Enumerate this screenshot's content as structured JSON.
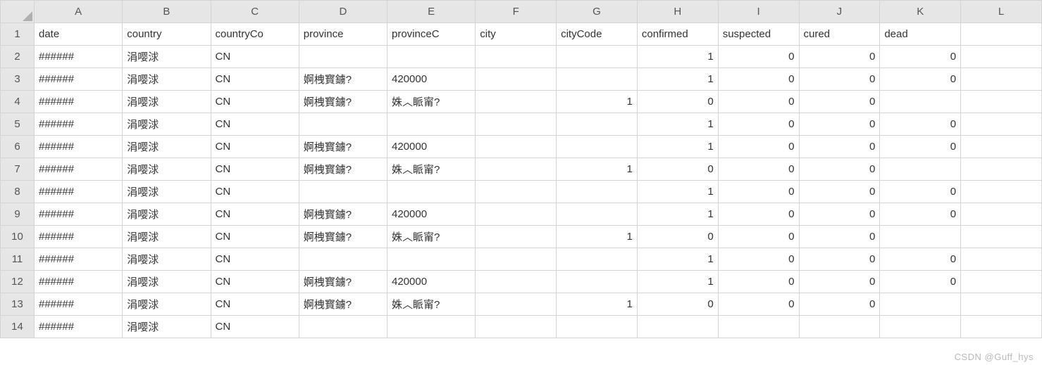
{
  "columns": [
    "A",
    "B",
    "C",
    "D",
    "E",
    "F",
    "G",
    "H",
    "I",
    "J",
    "K",
    "L"
  ],
  "headers": [
    "date",
    "country",
    "countryCo",
    "province",
    "provinceC",
    "city",
    "cityCode",
    "confirmed",
    "suspected",
    "cured",
    "dead",
    ""
  ],
  "rows": [
    [
      "######",
      "涓嘤浗",
      "CN",
      "",
      "",
      "",
      "",
      "1",
      "0",
      "0",
      "0",
      ""
    ],
    [
      "######",
      "涓嘤浗",
      "CN",
      "婀栧寳鐪?",
      "420000",
      "",
      "",
      "1",
      "0",
      "0",
      "0",
      ""
    ],
    [
      "######",
      "涓嘤浗",
      "CN",
      "婀栧寳鐪?",
      "姝︿眽甯?",
      "",
      "1",
      "0",
      "0",
      "0",
      "",
      ""
    ],
    [
      "######",
      "涓嘤浗",
      "CN",
      "",
      "",
      "",
      "",
      "1",
      "0",
      "0",
      "0",
      ""
    ],
    [
      "######",
      "涓嘤浗",
      "CN",
      "婀栧寳鐪?",
      "420000",
      "",
      "",
      "1",
      "0",
      "0",
      "0",
      ""
    ],
    [
      "######",
      "涓嘤浗",
      "CN",
      "婀栧寳鐪?",
      "姝︿眽甯?",
      "",
      "1",
      "0",
      "0",
      "0",
      "",
      ""
    ],
    [
      "######",
      "涓嘤浗",
      "CN",
      "",
      "",
      "",
      "",
      "1",
      "0",
      "0",
      "0",
      ""
    ],
    [
      "######",
      "涓嘤浗",
      "CN",
      "婀栧寳鐪?",
      "420000",
      "",
      "",
      "1",
      "0",
      "0",
      "0",
      ""
    ],
    [
      "######",
      "涓嘤浗",
      "CN",
      "婀栧寳鐪?",
      "姝︿眽甯?",
      "",
      "1",
      "0",
      "0",
      "0",
      "",
      ""
    ],
    [
      "######",
      "涓嘤浗",
      "CN",
      "",
      "",
      "",
      "",
      "1",
      "0",
      "0",
      "0",
      ""
    ],
    [
      "######",
      "涓嘤浗",
      "CN",
      "婀栧寳鐪?",
      "420000",
      "",
      "",
      "1",
      "0",
      "0",
      "0",
      ""
    ],
    [
      "######",
      "涓嘤浗",
      "CN",
      "婀栧寳鐪?",
      "姝︿眽甯?",
      "",
      "1",
      "0",
      "0",
      "0",
      "",
      ""
    ],
    [
      "######",
      "涓嘤浗",
      "CN",
      "",
      "",
      "",
      "",
      "",
      "",
      "",
      "",
      ""
    ]
  ],
  "watermark": "CSDN @Guff_hys",
  "numeric_columns": [
    "F",
    "G",
    "H",
    "I",
    "J",
    "K"
  ]
}
